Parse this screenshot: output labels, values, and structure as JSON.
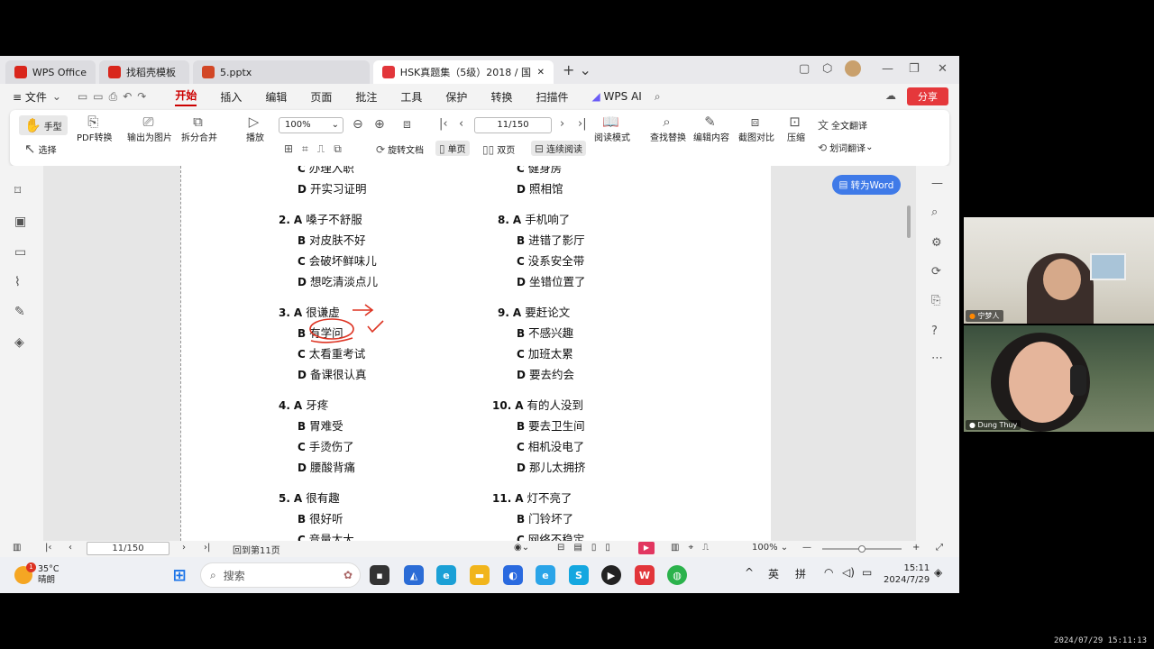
{
  "tabs": [
    {
      "label": "WPS Office",
      "color": "#d9261c"
    },
    {
      "label": "找稻壳模板",
      "color": "#d9261c"
    },
    {
      "label": "5.pptx",
      "color": "#d24726"
    },
    {
      "label": "HSK真题集（5级）2018 / 国",
      "color": "#e2363b",
      "active": true
    }
  ],
  "menu": {
    "file": "≡ 文件",
    "items": [
      "开始",
      "插入",
      "编辑",
      "页面",
      "批注",
      "工具",
      "保护",
      "转换",
      "扫描件"
    ],
    "active": "开始",
    "wps_ai": "WPS AI",
    "share": "分享"
  },
  "toolbar": {
    "hand": "手型",
    "select": "选择",
    "pdf_convert": "PDF转换",
    "export_image": "输出为图片",
    "split_merge": "拆分合并",
    "play": "播放",
    "zoom": "100%",
    "page": "11/150",
    "rotate": "旋转文档",
    "single": "单页",
    "double": "双页",
    "continuous": "连续阅读",
    "read_mode": "阅读模式",
    "find_replace": "查找替换",
    "edit_content": "编辑内容",
    "screenshot_compare": "截图对比",
    "compress": "压缩",
    "full_translate": "全文翻译",
    "word_translate": "划词翻译"
  },
  "to_word": "转为Word",
  "questions": {
    "q1_c": "办理入职",
    "q1_d": "开实习证明",
    "q7_c": "健身房",
    "q7_d": "照相馆",
    "q2": {
      "num": "2.",
      "A": "嗓子不舒服",
      "B": "对皮肤不好",
      "C": "会破坏鲜味儿",
      "D": "想吃清淡点儿"
    },
    "q8": {
      "num": "8.",
      "A": "手机响了",
      "B": "进错了影厅",
      "C": "没系安全带",
      "D": "坐错位置了"
    },
    "q3": {
      "num": "3.",
      "A": "很谦虚",
      "B": "有学问",
      "C": "太看重考试",
      "D": "备课很认真"
    },
    "q9": {
      "num": "9.",
      "A": "要赶论文",
      "B": "不感兴趣",
      "C": "加班太累",
      "D": "要去约会"
    },
    "q4": {
      "num": "4.",
      "A": "牙疼",
      "B": "胃难受",
      "C": "手烫伤了",
      "D": "腰酸背痛"
    },
    "q10": {
      "num": "10.",
      "A": "有的人没到",
      "B": "要去卫生间",
      "C": "相机没电了",
      "D": "那儿太拥挤"
    },
    "q5": {
      "num": "5.",
      "A": "很有趣",
      "B": "很好听",
      "C": "音量太大"
    },
    "q11": {
      "num": "11.",
      "A": "灯不亮了",
      "B": "门铃坏了",
      "C": "网络不稳定"
    }
  },
  "status": {
    "page": "11/150",
    "back_to": "回到第11页",
    "zoom": "100%"
  },
  "taskbar": {
    "temp": "35°C",
    "weather": "晴朗",
    "badge": "1",
    "search": "搜索",
    "ime_lang": "英",
    "ime_mode": "拼",
    "time": "15:11",
    "date": "2024/7/29"
  },
  "cams": {
    "cam1_name": "宁梦人",
    "cam2_name": "Dung Thuy"
  },
  "recording_timestamp": "2024/07/29 15:11:13"
}
